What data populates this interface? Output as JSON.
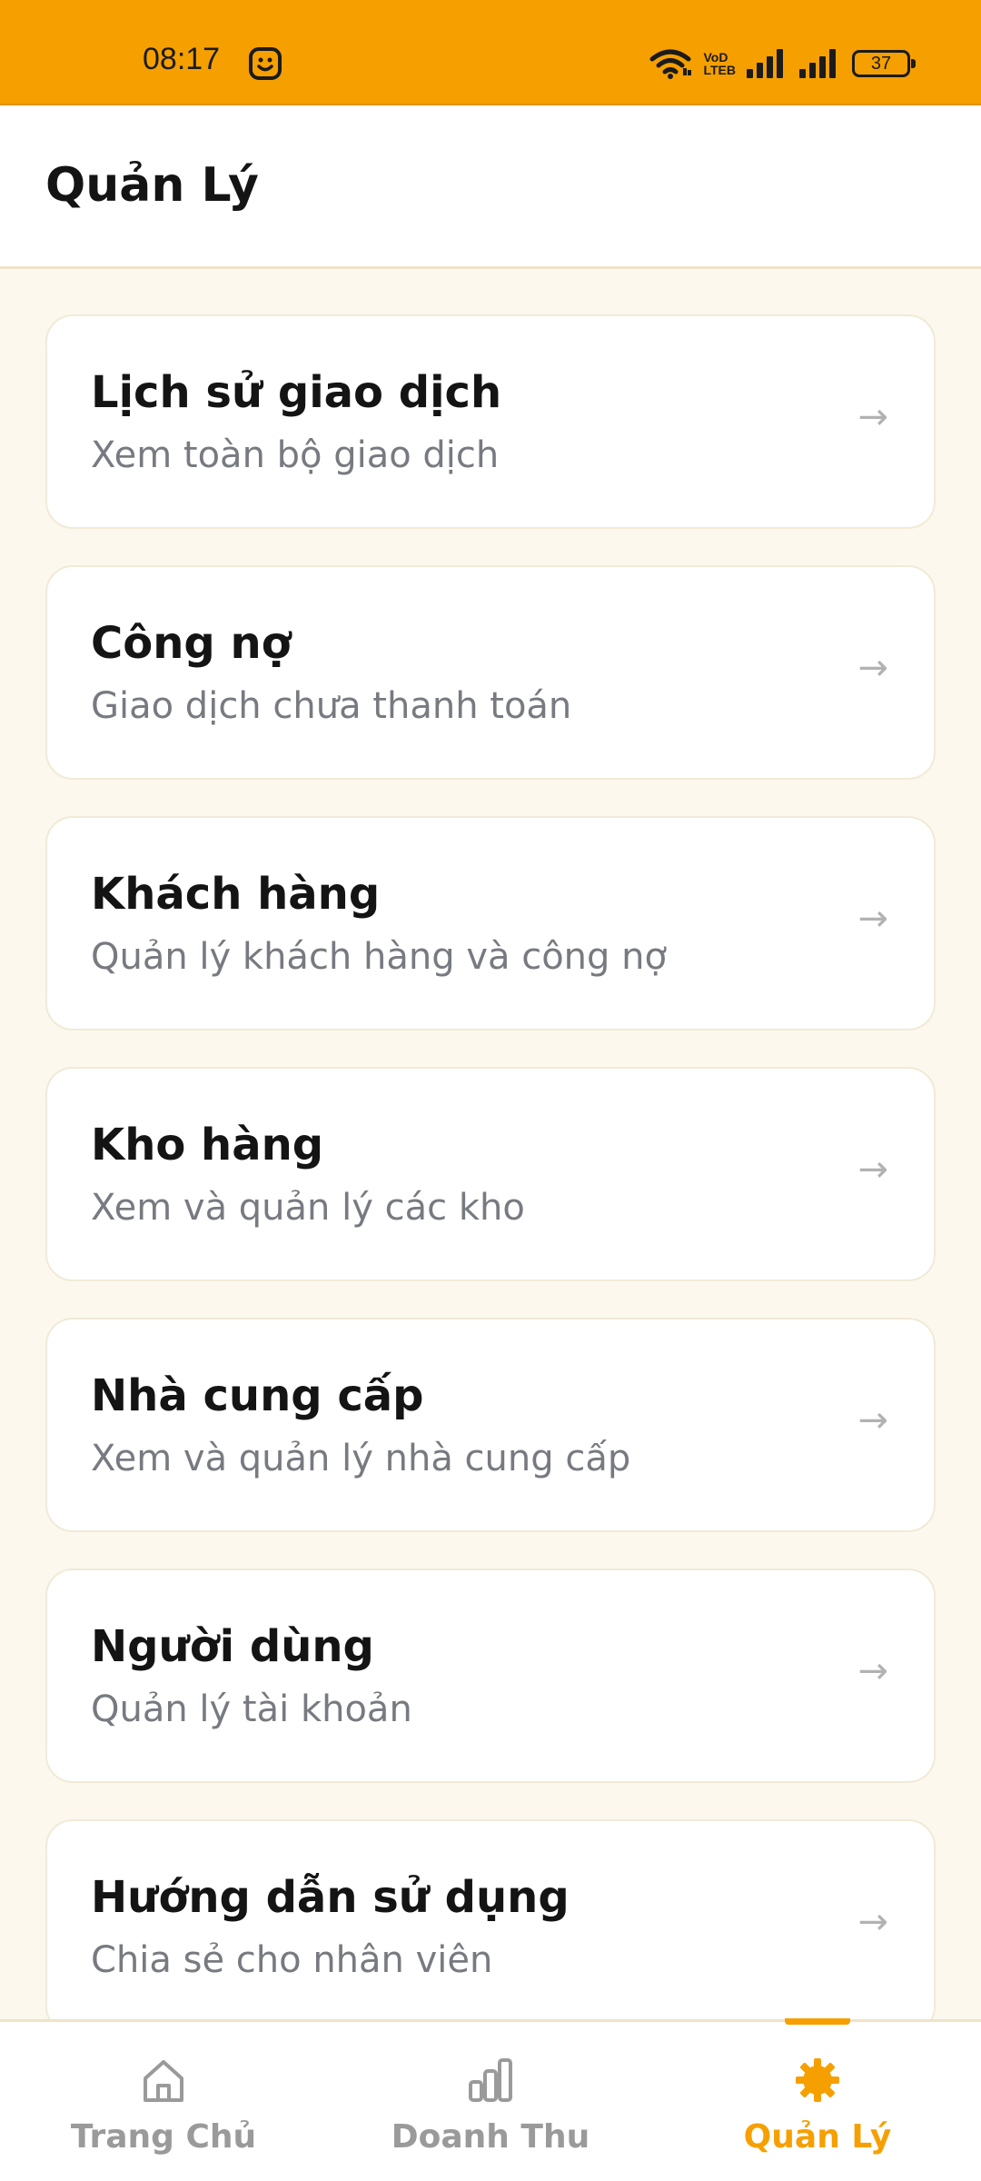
{
  "status_bar": {
    "time": "08:17",
    "battery": "37",
    "icons": [
      "smiley-icon",
      "wifi-icon",
      "volte-icon",
      "signal-icon",
      "signal-icon",
      "battery-icon"
    ],
    "volte_top": "VoD",
    "volte_bottom": "LTEB"
  },
  "header": {
    "title": "Quản Lý"
  },
  "menu": [
    {
      "title": "Lịch sử giao dịch",
      "subtitle": "Xem toàn bộ giao dịch",
      "arrow": "→"
    },
    {
      "title": "Công nợ",
      "subtitle": "Giao dịch chưa thanh toán",
      "arrow": "→"
    },
    {
      "title": "Khách hàng",
      "subtitle": "Quản lý khách hàng và công nợ",
      "arrow": "→"
    },
    {
      "title": "Kho hàng",
      "subtitle": "Xem và quản lý các kho",
      "arrow": "→"
    },
    {
      "title": "Nhà cung cấp",
      "subtitle": "Xem và quản lý nhà cung cấp",
      "arrow": "→"
    },
    {
      "title": "Người dùng",
      "subtitle": "Quản lý tài khoản",
      "arrow": "→"
    },
    {
      "title": "Hướng dẫn sử dụng",
      "subtitle": "Chia sẻ cho nhân viên",
      "arrow": "→"
    }
  ],
  "bottom_nav": {
    "items": [
      {
        "label": "Trang Chủ",
        "icon": "home-icon",
        "active": false
      },
      {
        "label": "Doanh Thu",
        "icon": "bar-chart-icon",
        "active": false
      },
      {
        "label": "Quản Lý",
        "icon": "gear-icon",
        "active": true
      }
    ]
  },
  "colors": {
    "accent": "#f5a000",
    "background": "#fcf8ee",
    "inactive": "#9a9a9a"
  }
}
